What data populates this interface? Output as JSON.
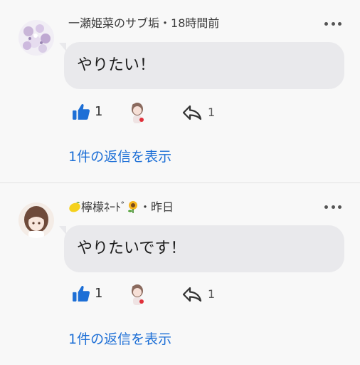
{
  "comments": [
    {
      "author": "一瀬姫菜のサブ垢",
      "separator": "・",
      "time": "18時間前",
      "text": "やりたい！",
      "like_count": "1",
      "reply_count": "1",
      "replies_link": "1件の返信を表示",
      "avatar_icon": "avatar-purple-flowers"
    },
    {
      "author_prefix_icon": "lemon-emoji",
      "author": "檸檬ﾈｰﾄﾞ",
      "author_suffix_icon": "sunflower-emoji",
      "separator": "・",
      "time": "昨日",
      "text": "やりたいです！",
      "like_count": "1",
      "reply_count": "1",
      "replies_link": "1件の返信を表示",
      "avatar_icon": "avatar-anime-girl"
    }
  ],
  "colors": {
    "background": "#f8f8f8",
    "bubble": "#e9e9ec",
    "like": "#1d6fd6",
    "link": "#1d6fd6",
    "divider": "#e2e2e2"
  },
  "icons": {
    "like": "thumbs-up-icon",
    "reply": "reply-arrow-icon",
    "more": "more-dots-icon",
    "reaction": "reaction-user-avatar"
  }
}
